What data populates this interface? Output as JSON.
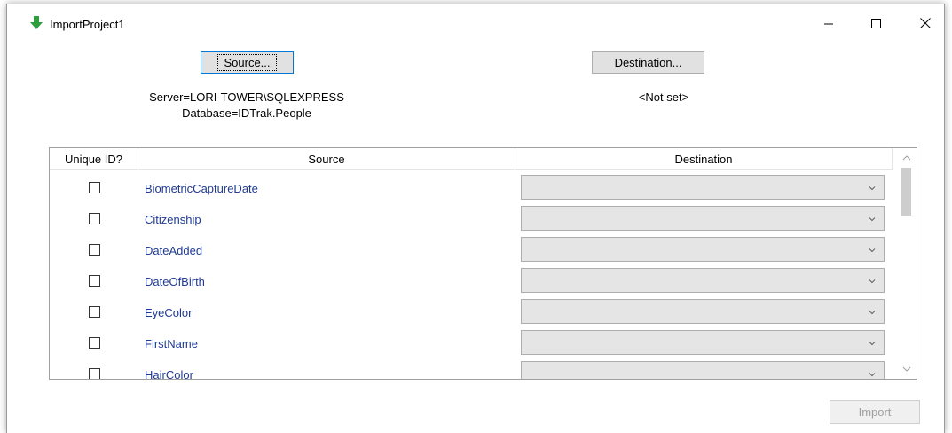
{
  "window": {
    "title": "ImportProject1"
  },
  "source_button": {
    "label": "Source..."
  },
  "destination_button": {
    "label": "Destination..."
  },
  "source_info": {
    "line1": "Server=LORI-TOWER\\SQLEXPRESS",
    "line2": "Database=IDTrak.People"
  },
  "destination_info": {
    "text": "<Not set>"
  },
  "grid": {
    "headers": [
      "Unique ID?",
      "Source",
      "Destination"
    ],
    "rows": [
      {
        "source": "BiometricCaptureDate",
        "unique": false,
        "destination": ""
      },
      {
        "source": "Citizenship",
        "unique": false,
        "destination": ""
      },
      {
        "source": "DateAdded",
        "unique": false,
        "destination": ""
      },
      {
        "source": "DateOfBirth",
        "unique": false,
        "destination": ""
      },
      {
        "source": "EyeColor",
        "unique": false,
        "destination": ""
      },
      {
        "source": "FirstName",
        "unique": false,
        "destination": ""
      },
      {
        "source": "HairColor",
        "unique": false,
        "destination": ""
      }
    ]
  },
  "import_button": {
    "label": "Import",
    "enabled": false
  },
  "colors": {
    "app_icon": "#2e9e3f",
    "link_text": "#1f3a93",
    "focus_border": "#0078d7"
  },
  "icons": {
    "app": "green-down-arrow-icon",
    "minimize": "minimize-icon",
    "maximize": "maximize-icon",
    "close": "close-icon"
  }
}
